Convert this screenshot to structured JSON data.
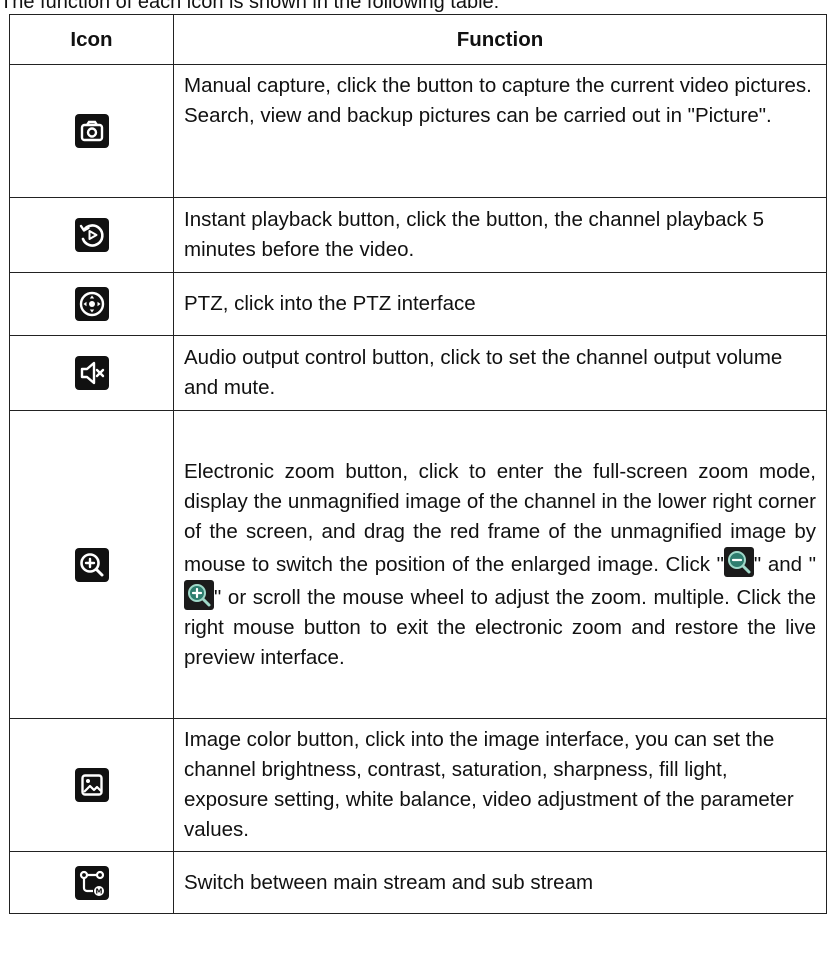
{
  "intro_text": "The function of each icon is shown in the following table:",
  "table": {
    "headers": {
      "icon": "Icon",
      "function": "Function"
    },
    "rows": [
      {
        "icon": "camera-icon",
        "function": "Manual capture, click the button to capture the current video pictures. Search, view and backup pictures can be carried out in \"Picture\"."
      },
      {
        "icon": "instant-playback-icon",
        "function": "Instant playback button, click the button, the channel playback 5 minutes before the video."
      },
      {
        "icon": "ptz-icon",
        "function": "PTZ, click into the PTZ interface"
      },
      {
        "icon": "audio-mute-icon",
        "function": "Audio output control button, click to set the channel output volume and mute."
      },
      {
        "icon": "zoom-in-icon",
        "function_part1": "Electronic zoom button, click to enter the full-screen zoom mode, display the unmagnified image of the channel in the lower right corner of the screen, and drag the red frame of the unmagnified image by mouse to switch the position of the enlarged image. Click \"",
        "inline_icon_1": "zoom-out-icon",
        "function_part2": "\" and \"",
        "inline_icon_2": "zoom-in-icon",
        "function_part3": "\" or scroll the mouse wheel to adjust the zoom. multiple. Click the right mouse button to exit the electronic zoom and restore the live preview interface."
      },
      {
        "icon": "image-color-icon",
        "function": "Image color button, click into the image interface, you can set the channel brightness, contrast, saturation, sharpness, fill light, exposure setting, white balance, video adjustment of the parameter values."
      },
      {
        "icon": "stream-switch-icon",
        "function": "Switch between main stream and sub stream"
      }
    ]
  },
  "colors": {
    "icon_bg": "#111111",
    "icon_fg": "#ffffff",
    "border": "#222222"
  }
}
